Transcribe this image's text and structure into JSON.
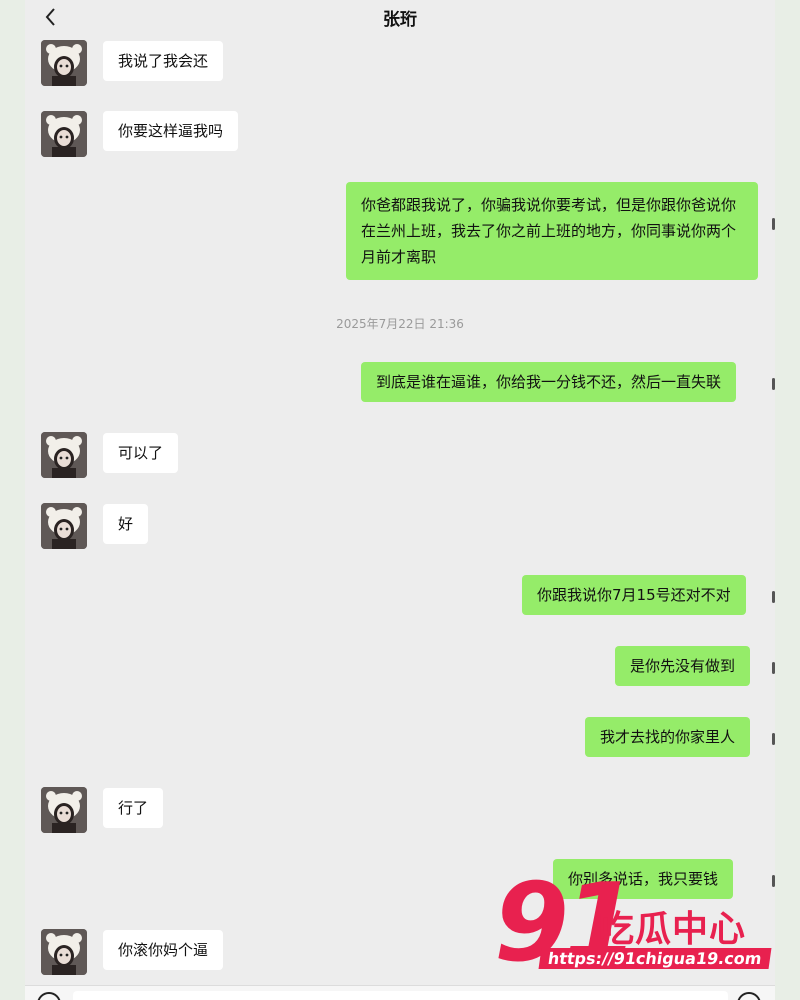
{
  "header": {
    "title": "张珩"
  },
  "timestamp": "2025年7月22日 21:36",
  "messages": [
    {
      "side": "left",
      "text": "我说了我会还"
    },
    {
      "side": "left",
      "text": "你要这样逼我吗"
    },
    {
      "side": "right",
      "text": "你爸都跟我说了，你骗我说你要考试，但是你跟你爸说你在兰州上班，我去了你之前上班的地方，你同事说你两个月前才离职"
    },
    {
      "side": "right",
      "text": "到底是谁在逼谁，你给我一分钱不还，然后一直失联"
    },
    {
      "side": "left",
      "text": "可以了"
    },
    {
      "side": "left",
      "text": "好"
    },
    {
      "side": "right",
      "text": "你跟我说你7月15号还对不对"
    },
    {
      "side": "right",
      "text": "是你先没有做到"
    },
    {
      "side": "right",
      "text": "我才去找的你家里人"
    },
    {
      "side": "left",
      "text": "行了"
    },
    {
      "side": "right",
      "text": "你别多说话，我只要钱"
    },
    {
      "side": "left",
      "text": "你滚你妈个逼"
    }
  ],
  "watermark": {
    "number": "91",
    "brand": "吃瓜中心",
    "url": "https://91chigua19.com"
  },
  "colors": {
    "self_bubble": "#95ec69",
    "other_bubble": "#ffffff",
    "background": "#ededed",
    "watermark": "#e8214f"
  }
}
